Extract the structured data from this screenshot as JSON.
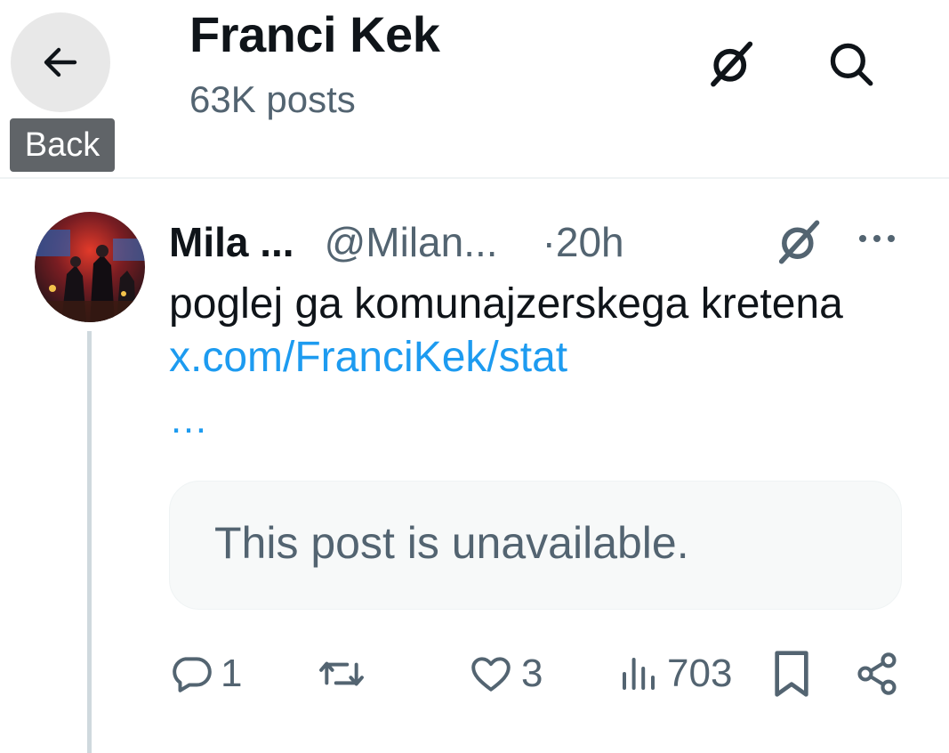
{
  "header": {
    "title": "Franci Kek",
    "subtitle": "63K posts",
    "back_tooltip": "Back"
  },
  "icons": {
    "back": "arrow-left-icon",
    "grok": "grok-icon",
    "search": "search-icon",
    "more": "more-icon",
    "reply": "reply-icon",
    "repost": "repost-icon",
    "like": "heart-icon",
    "views": "views-icon",
    "bookmark": "bookmark-icon",
    "share": "share-icon"
  },
  "post": {
    "author_name": "Mila ...",
    "author_handle": "@Milan...",
    "time": "·20h",
    "text": "poglej ga komunajzerskega kretena ",
    "link": "x.com/FranciKek/stat",
    "link_ellipsis": "…",
    "quoted_unavailable": "This post is unavailable.",
    "stats": {
      "replies": "1",
      "likes": "3",
      "views": "703"
    }
  },
  "colors": {
    "text_primary": "#0f1419",
    "text_secondary": "#536471",
    "link": "#1d9bf0",
    "tooltip_bg": "#606468",
    "back_button_bg": "#e8e8e8",
    "thread_line": "#cfd9de",
    "quoted_bg": "#f7f9f9"
  }
}
